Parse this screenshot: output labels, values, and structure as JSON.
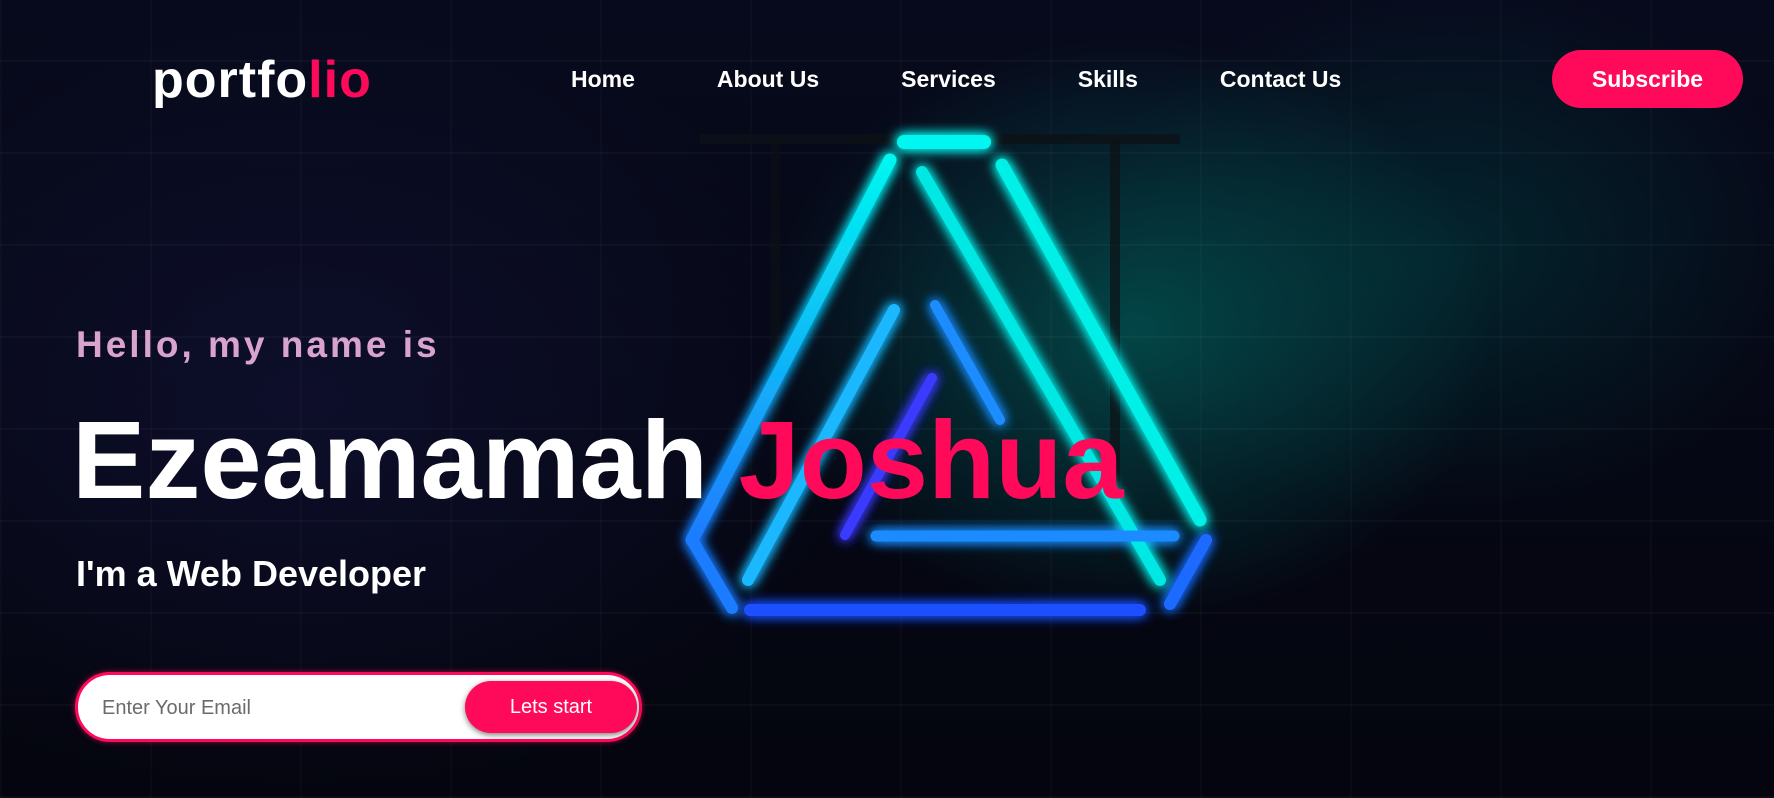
{
  "brand": {
    "logo_main": "portfo",
    "logo_accent": "lio",
    "accent_color": "#ff0a5a"
  },
  "nav": {
    "items": [
      {
        "label": "Home"
      },
      {
        "label": "About Us"
      },
      {
        "label": "Services"
      },
      {
        "label": "Skills"
      },
      {
        "label": "Contact Us"
      }
    ],
    "subscribe_label": "Subscribe"
  },
  "hero": {
    "greeting": "Hello, my name is",
    "first_name": "Ezeamamah",
    "last_name": "Joshua",
    "role": "I'm a Web Developer",
    "greeting_color": "#d9a3d0"
  },
  "signup": {
    "email_placeholder": "Enter Your Email",
    "email_value": "",
    "button_label": "Lets start"
  },
  "background": {
    "art": "neon-triangle-icon",
    "art_colors": [
      "#00f6f0",
      "#1e6bff",
      "#2a2aff"
    ]
  }
}
